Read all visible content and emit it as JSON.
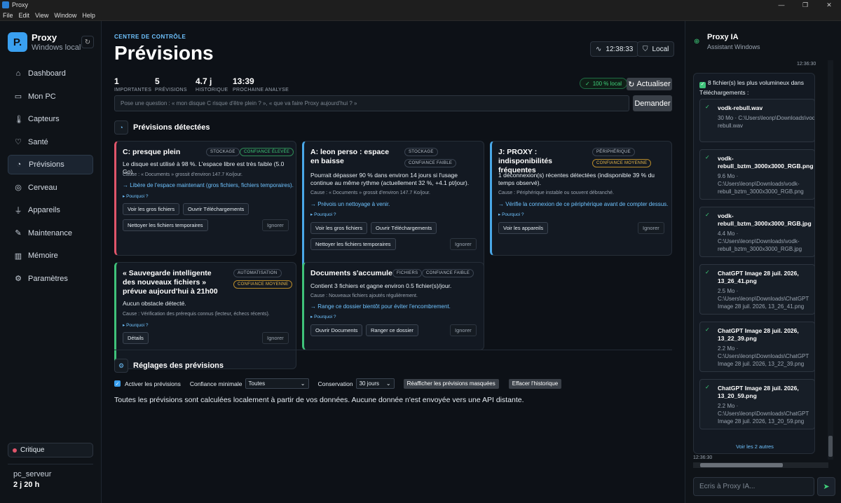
{
  "window": {
    "title": "Proxy",
    "controls": [
      "—",
      "❐",
      "✕"
    ]
  },
  "menu": [
    "File",
    "Edit",
    "View",
    "Window",
    "Help"
  ],
  "brand": {
    "logo": "P.",
    "name": "Proxy",
    "sub": "Windows local",
    "refresh_icon": "↻"
  },
  "nav": [
    {
      "label": "Dashboard",
      "icon": "house-icon",
      "glyph": "⌂"
    },
    {
      "label": "Mon PC",
      "icon": "monitor-icon",
      "glyph": "▭"
    },
    {
      "label": "Capteurs",
      "icon": "thermometer-icon",
      "glyph": "🌡"
    },
    {
      "label": "Santé",
      "icon": "heart-icon",
      "glyph": "♡"
    },
    {
      "label": "Prévisions",
      "icon": "forecast-icon",
      "glyph": "◔"
    },
    {
      "label": "Cerveau",
      "icon": "globe-icon",
      "glyph": "◎"
    },
    {
      "label": "Appareils",
      "icon": "plug-icon",
      "glyph": "⏚"
    },
    {
      "label": "Maintenance",
      "icon": "wrench-icon",
      "glyph": "✎"
    },
    {
      "label": "Mémoire",
      "icon": "book-icon",
      "glyph": "▥"
    },
    {
      "label": "Paramètres",
      "icon": "gear-icon",
      "glyph": "⚙"
    }
  ],
  "status": {
    "label": "Critique",
    "color": "#e0556a"
  },
  "host": {
    "name": "pc_serveur",
    "uptime": "2 j 20 h"
  },
  "header": {
    "crumb": "CENTRE DE CONTRÔLE",
    "title": "Prévisions",
    "time": "12:38:33",
    "local": "Local"
  },
  "stats": [
    {
      "value": "1",
      "label": "IMPORTANTES"
    },
    {
      "value": "5",
      "label": "PRÉVISIONS"
    },
    {
      "value": "4.7 j",
      "label": "HISTORIQUE"
    },
    {
      "value": "13:39",
      "label": "PROCHAINE ANALYSE"
    }
  ],
  "local_badge": "100 % local",
  "refresh_label": "Actualiser",
  "ask": {
    "placeholder": "Pose une question : « mon disque C risque d'être plein ? », « que va faire Proxy aujourd'hui ? »",
    "button": "Demander"
  },
  "sections": {
    "detected": "Prévisions détectées",
    "settings": "Réglages des prévisions"
  },
  "cards": [
    {
      "title": "C: presque plein",
      "tag": "STOCKAGE",
      "confidence": "CONFIANCE ÉLEVÉE",
      "desc": "Le disque est utilisé à 98 %. L'espace libre est très faible (5.0 Go).",
      "cause": "Cause : « Documents » grossit d'environ 147.7 Ko/jour.",
      "action": "→ Libère de l'espace maintenant (gros fichiers, fichiers temporaires).",
      "why": "▸ Pourquoi ?",
      "buttons": [
        "Voir les gros fichiers",
        "Ouvrir Téléchargements",
        "Nettoyer les fichiers temporaires"
      ],
      "ignore": "Ignorer"
    },
    {
      "title": "A: leon perso : espace en baisse",
      "tag": "STOCKAGE",
      "confidence": "CONFIANCE FAIBLE",
      "desc": "Pourrait dépasser 90 % dans environ 14 jours si l'usage continue au même rythme (actuellement 32 %, +4.1 pt/jour).",
      "cause": "Cause : « Documents » grossit d'environ 147.7 Ko/jour.",
      "action": "→ Prévois un nettoyage à venir.",
      "why": "▸ Pourquoi ?",
      "buttons": [
        "Voir les gros fichiers",
        "Ouvrir Téléchargements",
        "Nettoyer les fichiers temporaires"
      ],
      "ignore": "Ignorer"
    },
    {
      "title": "J: PROXY : indisponibilités fréquentes",
      "tag": "PÉRIPHÉRIQUE",
      "confidence": "CONFIANCE MOYENNE",
      "desc": "1 déconnexion(s) récentes détectées (indisponible 39 % du temps observé).",
      "cause": "Cause : Périphérique instable ou souvent débranché.",
      "action": "→ Vérifie la connexion de ce périphérique avant de compter dessus.",
      "why": "▸ Pourquoi ?",
      "buttons": [
        "Voir les appareils"
      ],
      "ignore": "Ignorer"
    },
    {
      "title": "« Sauvegarde intelligente des nouveaux fichiers » prévue aujourd'hui à 21h00",
      "tag": "AUTOMATISATION",
      "confidence": "CONFIANCE MOYENNE",
      "desc": "Aucun obstacle détecté.",
      "cause": "Cause : Vérification des prérequis connus (lecteur, échecs récents).",
      "why": "▸ Pourquoi ?",
      "buttons": [
        "Détails"
      ],
      "ignore": "Ignorer"
    },
    {
      "title": "Documents s'accumule",
      "tag": "FICHIERS",
      "confidence": "CONFIANCE FAIBLE",
      "desc": "Contient 3 fichiers et gagne environ 0.5 fichier(s)/jour.",
      "cause": "Cause : Nouveaux fichiers ajoutés régulièrement.",
      "action": "→ Range ce dossier bientôt pour éviter l'encombrement.",
      "why": "▸ Pourquoi ?",
      "buttons": [
        "Ouvrir Documents",
        "Ranger ce dossier"
      ],
      "ignore": "Ignorer"
    }
  ],
  "settings": {
    "enable_label": "Activer les prévisions",
    "min_conf_label": "Confiance minimale",
    "min_conf_value": "Toutes",
    "retention_label": "Conservation",
    "retention_value": "30 jours",
    "show_hidden": "Réafficher les prévisions masquées",
    "clear_history": "Effacer l'historique",
    "note": "Toutes les prévisions sont calculées localement à partir de vos données. Aucune donnée n'est envoyée vers une API distante."
  },
  "chat": {
    "title": "Proxy IA",
    "sub": "Assistant Windows",
    "time_top": "12:36:30",
    "time_bottom": "12:36:30",
    "msg_head": "8 fichier(s) les plus volumineux dans Téléchargements :",
    "files": [
      {
        "name": "vodk-rebull.wav",
        "path": "30 Mo · C:\\Users\\leonp\\Downloads\\vodk-rebull.wav"
      },
      {
        "name": "vodk-rebull_bztm_3000x3000_RGB.png",
        "path": "9.6 Mo · C:\\Users\\leonp\\Downloads\\vodk-rebull_bztm_3000x3000_RGB.png"
      },
      {
        "name": "vodk-rebull_bztm_3000x3000_RGB.jpg",
        "path": "4.4 Mo · C:\\Users\\leonp\\Downloads\\vodk-rebull_bztm_3000x3000_RGB.jpg"
      },
      {
        "name": "ChatGPT Image 28 juil. 2026, 13_26_41.png",
        "path": "2.5 Mo · C:\\Users\\leonp\\Downloads\\ChatGPT Image 28 juil. 2026, 13_26_41.png"
      },
      {
        "name": "ChatGPT Image 28 juil. 2026, 13_22_39.png",
        "path": "2.2 Mo · C:\\Users\\leonp\\Downloads\\ChatGPT Image 28 juil. 2026, 13_22_39.png"
      },
      {
        "name": "ChatGPT Image 28 juil. 2026, 13_20_59.png",
        "path": "2.2 Mo · C:\\Users\\leonp\\Downloads\\ChatGPT Image 28 juil. 2026, 13_20_59.png"
      }
    ],
    "more": "Voir les 2 autres",
    "input_placeholder": "Écris à Proxy IA...",
    "send_icon": "➤"
  }
}
